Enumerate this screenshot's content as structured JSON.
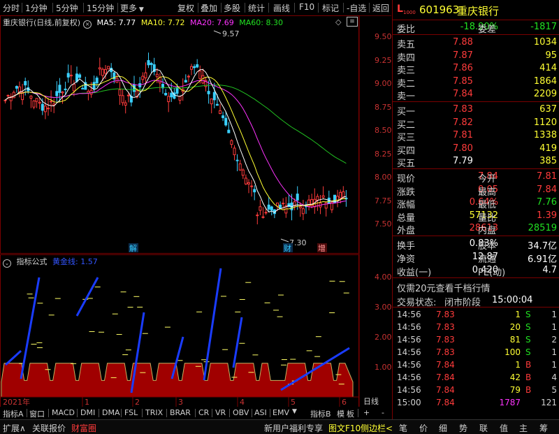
{
  "toolbar": {
    "left": [
      "分时",
      "1分钟",
      "5分钟",
      "15分钟",
      "更多"
    ],
    "right": [
      "复权",
      "叠加",
      "多股",
      "统计",
      "画线",
      "F10",
      "标记",
      "-自选",
      "返回"
    ]
  },
  "title": {
    "stock": "重庆银行(日线,前复权)",
    "ma5": "MA5: 7.77",
    "ma10": "MA10: 7.72",
    "ma20": "MA20: 7.69",
    "ma60": "MA60: 8.30"
  },
  "price_axis": [
    "9.50",
    "9.25",
    "9.00",
    "8.75",
    "8.50",
    "8.25",
    "8.00",
    "7.75",
    "7.50"
  ],
  "price_annotations": {
    "high": "9.57",
    "low": "7.30"
  },
  "markers": [
    "解",
    "财",
    "增"
  ],
  "indicator": {
    "title": "指标公式",
    "line_label": "黄金线: 1.57",
    "axis": [
      "4.00",
      "3.00",
      "2.00",
      "1.00"
    ]
  },
  "time_axis": [
    "2021年",
    "1",
    "2",
    "3",
    "4",
    "5",
    "6"
  ],
  "bottom_tabs": [
    "指标A",
    "窗口",
    "MACD",
    "DMI",
    "DMA",
    "FSL",
    "TRIX",
    "BRAR",
    "CR",
    "VR",
    "OBV",
    "ASI",
    "EMV",
    "指标B",
    "模",
    "板",
    "+",
    "-",
    "日线"
  ],
  "status": {
    "left": [
      "扩展∧",
      "关联报价",
      "财富圈"
    ],
    "right": [
      "新用户福利专享",
      "图文F10",
      "侧边栏<"
    ],
    "right_panel_tabs": [
      "笔",
      "价",
      "细",
      "势",
      "联",
      "值",
      "主",
      "筹"
    ]
  },
  "quote": {
    "code": "601963",
    "name": "重庆银行",
    "weibi_label": "委比",
    "weibi": "-18.90%",
    "weicha_label": "委差",
    "weicha": "-1817",
    "asks": [
      {
        "label": "卖五",
        "price": "7.88",
        "vol": "1034"
      },
      {
        "label": "卖四",
        "price": "7.87",
        "vol": "95"
      },
      {
        "label": "卖三",
        "price": "7.86",
        "vol": "414"
      },
      {
        "label": "卖二",
        "price": "7.85",
        "vol": "1864"
      },
      {
        "label": "卖一",
        "price": "7.84",
        "vol": "2209"
      }
    ],
    "bids": [
      {
        "label": "买一",
        "price": "7.83",
        "vol": "637"
      },
      {
        "label": "买二",
        "price": "7.82",
        "vol": "1120"
      },
      {
        "label": "买三",
        "price": "7.81",
        "vol": "1338"
      },
      {
        "label": "买四",
        "price": "7.80",
        "vol": "419"
      },
      {
        "label": "买五",
        "price": "7.79",
        "vol": "385"
      }
    ],
    "stats": [
      {
        "l1": "现价",
        "v1": "7.84",
        "l2": "今开",
        "v2": "7.81"
      },
      {
        "l1": "涨跌",
        "v1": "0.05",
        "l2": "最高",
        "v2": "7.84"
      },
      {
        "l1": "涨幅",
        "v1": "0.64%",
        "l2": "最低",
        "v2": "7.76"
      },
      {
        "l1": "总量",
        "v1": "57132",
        "l2": "量比",
        "v2": "1.39"
      },
      {
        "l1": "外盘",
        "v1": "28613",
        "l2": "内盘",
        "v2": "28519"
      }
    ],
    "stats2": [
      {
        "l1": "换手",
        "v1": "0.83%",
        "l2": "股本",
        "v2": "34.7亿"
      },
      {
        "l1": "净资",
        "v1": "12.87",
        "l2": "流通",
        "v2": "6.91亿"
      },
      {
        "l1": "收益(一)",
        "v1": "0.420",
        "l2": "PE(动)",
        "v2": "4.7"
      }
    ],
    "promo": "仅需20元查看千档行情",
    "trade_status_label": "交易状态:",
    "trade_status": "闭市阶段",
    "trade_time": "15:00:04",
    "ticks": [
      {
        "t": "14:56",
        "p": "7.83",
        "v": "1",
        "s": "S",
        "n": "1"
      },
      {
        "t": "14:56",
        "p": "7.83",
        "v": "20",
        "s": "S",
        "n": "1"
      },
      {
        "t": "14:56",
        "p": "7.83",
        "v": "81",
        "s": "S",
        "n": "2"
      },
      {
        "t": "14:56",
        "p": "7.83",
        "v": "100",
        "s": "S",
        "n": "1"
      },
      {
        "t": "14:56",
        "p": "7.84",
        "v": "1",
        "s": "B",
        "n": "1"
      },
      {
        "t": "14:56",
        "p": "7.84",
        "v": "42",
        "s": "B",
        "n": "4"
      },
      {
        "t": "14:56",
        "p": "7.84",
        "v": "79",
        "s": "B",
        "n": "5"
      },
      {
        "t": "15:00",
        "p": "7.84",
        "v": "1787",
        "s": "",
        "n": "121"
      }
    ]
  }
}
